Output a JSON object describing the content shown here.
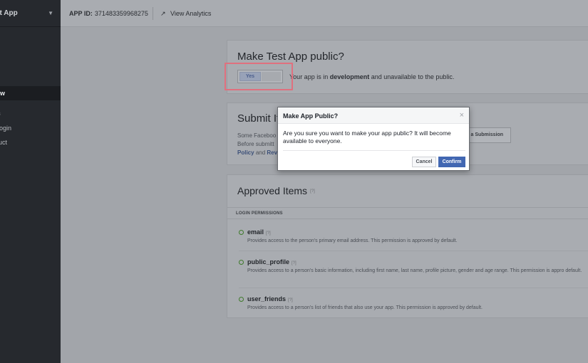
{
  "sidebar": {
    "app_name": "st App",
    "items": {
      "dashboard": "ew",
      "products_header": "s",
      "login": "Login",
      "add_product": "uct"
    }
  },
  "topbar": {
    "app_id_label": "APP ID:",
    "app_id_value": "371483359968275",
    "view_analytics": "View Analytics"
  },
  "public_card": {
    "title": "Make Test App public?",
    "toggle_yes": "Yes",
    "status_prefix": "Your app is in",
    "status_bold": "development",
    "status_suffix": "and unavailable to the public."
  },
  "submit_card": {
    "title": "Submit It",
    "line1": "Some Faceboo",
    "line2": "Before submitt",
    "line3_link1": "Policy",
    "line3_mid": "and",
    "line3_link2": "Rev",
    "submission_button": "a Submission"
  },
  "approved_card": {
    "title": "Approved Items",
    "help": "[?]",
    "section_label": "LOGIN PERMISSIONS",
    "permissions": [
      {
        "name": "email",
        "help": "[?]",
        "description": "Provides access to the person's primary email address. This permission is approved by default."
      },
      {
        "name": "public_profile",
        "help": "[?]",
        "description": "Provides access to a person's basic information, including first name, last name, profile picture, gender and age range. This permission is appro default."
      },
      {
        "name": "user_friends",
        "help": "[?]",
        "description": "Provides access to a person's list of friends that also use your app. This permission is approved by default."
      }
    ]
  },
  "modal": {
    "title": "Make App Public?",
    "close": "×",
    "body": "Are you sure you want to make your app public? It will become available to everyone.",
    "cancel": "Cancel",
    "confirm": "Confirm"
  },
  "colors": {
    "sidebar_bg": "#26292e",
    "overlay_bg": "#a2a5aa",
    "confirm_blue": "#4267b2",
    "highlight_red": "#e0707e",
    "approved_green": "#3f7a2b"
  }
}
